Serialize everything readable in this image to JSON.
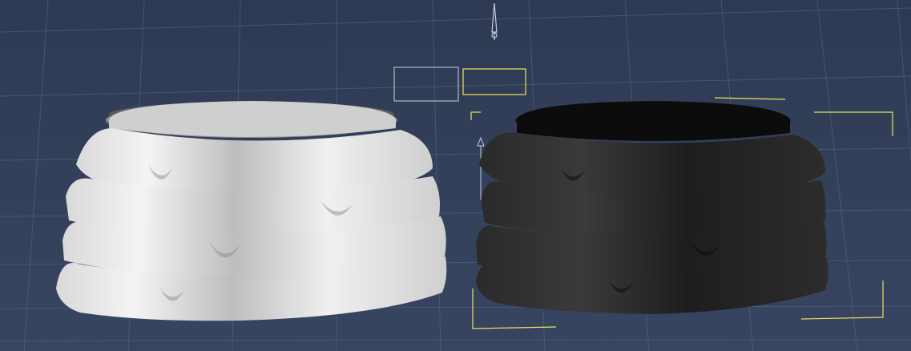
{
  "scene": {
    "background_color": "#34415b",
    "grid_color": "#5b6985",
    "selection_color": "#e6e35a",
    "bbox_color": "#c9ced8",
    "objects": [
      {
        "name": "white-ruffle-skirt",
        "color": "#e9e9e9",
        "tiers": 4,
        "selected": false
      },
      {
        "name": "black-ruffle-skirt",
        "color": "#222222",
        "tiers": 4,
        "selected": true
      }
    ],
    "icons": [
      "light-icon",
      "camera-icon"
    ]
  }
}
